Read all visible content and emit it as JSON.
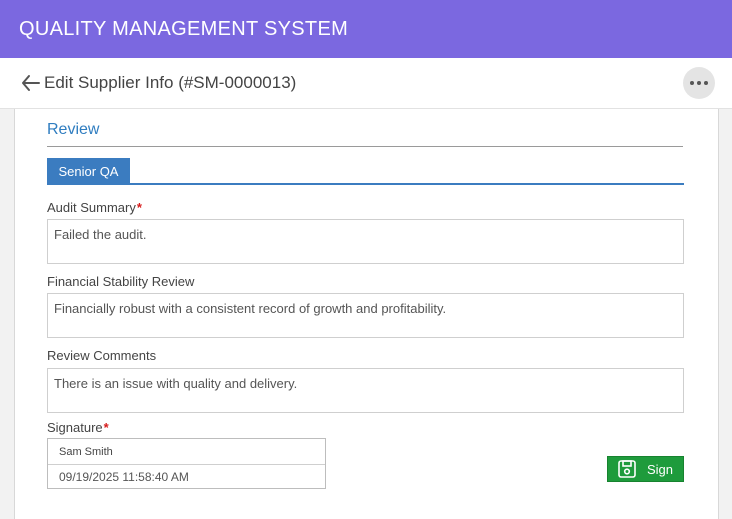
{
  "app": {
    "title": "QUALITY MANAGEMENT SYSTEM"
  },
  "subheader": {
    "title": "Edit Supplier Info (#SM-0000013)",
    "back_icon": "arrow-left-icon",
    "more_icon": "more-horizontal-icon"
  },
  "review": {
    "section_title": "Review",
    "tabs": [
      {
        "label": "Senior QA"
      }
    ],
    "fields": [
      {
        "label": "Audit Summary",
        "required": "*",
        "value": "Failed the audit."
      },
      {
        "label": "Financial Stability Review",
        "value": "Financially robust with a consistent record of growth and profitability."
      },
      {
        "label": "Review Comments",
        "value": "There is an issue with quality and delivery."
      }
    ],
    "signature": {
      "label": "Signature",
      "required": "*",
      "name": "Sam Smith",
      "datetime": "09/19/2025 11:58:40 AM"
    },
    "sign_button": {
      "label": "Sign",
      "icon": "save-icon"
    }
  },
  "colors": {
    "header": "#7b68e0",
    "accent": "#3b7cc0",
    "sign_button": "#1e9b3c",
    "required": "#d61a1a"
  }
}
